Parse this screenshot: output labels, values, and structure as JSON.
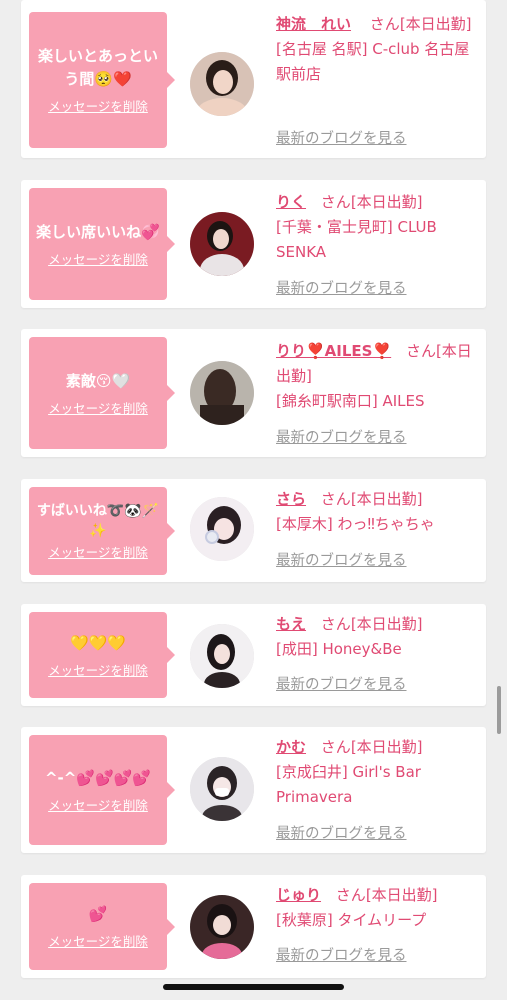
{
  "cards": [
    {
      "message": "楽しいとあっという間🥺❤️",
      "delete_label": "メッセージを削除",
      "name": "神流　れい",
      "honorific": "さん",
      "status": "[本日出勤]",
      "shop": "[名古屋 名駅] C-club 名古屋駅前店",
      "blog_label": "最新のブログを見る",
      "avatar_icon": "profile-photo"
    },
    {
      "message": "楽しい席いいね💞",
      "delete_label": "メッセージを削除",
      "name": "りく",
      "honorific": "さん",
      "status": "[本日出勤]",
      "shop": "[千葉・富士見町] CLUB SENKA",
      "blog_label": "最新のブログを見る",
      "avatar_icon": "profile-photo"
    },
    {
      "message": "素敵😚🤍",
      "delete_label": "メッセージを削除",
      "name": "りり❣️AILES❣️",
      "honorific": "さん",
      "status": "[本日出勤]",
      "shop": "[錦糸町駅南口] AILES",
      "blog_label": "最新のブログを見る",
      "avatar_icon": "profile-photo"
    },
    {
      "message": "すばいいね➰🐼🪄✨",
      "delete_label": "メッセージを削除",
      "name": "さら",
      "honorific": "さん",
      "status": "[本日出勤]",
      "shop": "[本厚木] わっ‼︎ちゃちゃ",
      "blog_label": "最新のブログを見る",
      "avatar_icon": "profile-photo"
    },
    {
      "message": "💛💛💛",
      "delete_label": "メッセージを削除",
      "name": "もえ",
      "honorific": "さん",
      "status": "[本日出勤]",
      "shop": "[成田] Honey&Be",
      "blog_label": "最新のブログを見る",
      "avatar_icon": "profile-photo"
    },
    {
      "message": "^-^💕💕💕💕",
      "delete_label": "メッセージを削除",
      "name": "かむ",
      "honorific": "さん",
      "status": "[本日出勤]",
      "shop": "[京成臼井] Girl's Bar Primavera",
      "blog_label": "最新のブログを見る",
      "avatar_icon": "profile-photo"
    },
    {
      "message": "💕",
      "delete_label": "メッセージを削除",
      "name": "じゅり",
      "honorific": "さん",
      "status": "[本日出勤]",
      "shop": "[秋葉原] タイムリープ",
      "blog_label": "最新のブログを見る",
      "avatar_icon": "profile-photo"
    }
  ],
  "colors": {
    "accent": "#e04a73",
    "bubble": "#f8a1b3",
    "background": "#eeeeee",
    "link_gray": "#9a9a9a"
  }
}
